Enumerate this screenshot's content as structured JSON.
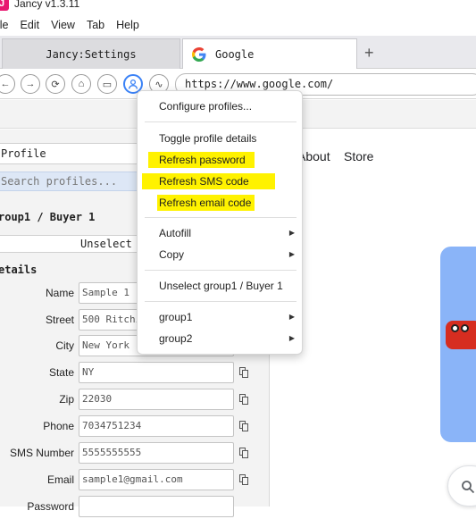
{
  "app": {
    "title": "Jancy v1.3.11",
    "logo_letter": "J"
  },
  "menubar": [
    "ile",
    "Edit",
    "View",
    "Tab",
    "Help"
  ],
  "tabs": [
    {
      "label": "Jancy:Settings",
      "active": false
    },
    {
      "label": "Google",
      "active": true
    }
  ],
  "new_tab_symbol": "+",
  "nav": {
    "url": "https://www.google.com/"
  },
  "panel": {
    "profile_select": "Profile",
    "search_placeholder": "Search profiles...",
    "group_label": "roup1 / Buyer 1",
    "unselect_label": "Unselect Prof",
    "details_label": "etails",
    "fields": [
      {
        "label": "Name",
        "value": "Sample 1"
      },
      {
        "label": "Street",
        "value": "500 Ritchie"
      },
      {
        "label": "City",
        "value": "New York"
      },
      {
        "label": "State",
        "value": "NY"
      },
      {
        "label": "Zip",
        "value": "22030"
      },
      {
        "label": "Phone",
        "value": "7034751234"
      },
      {
        "label": "SMS Number",
        "value": "5555555555"
      },
      {
        "label": "Email",
        "value": "sample1@gmail.com"
      },
      {
        "label": "Password",
        "value": ""
      }
    ]
  },
  "google": {
    "about": "About",
    "store": "Store"
  },
  "context_menu": {
    "configure": "Configure profiles...",
    "toggle_details": "Toggle profile details",
    "refresh_password": "Refresh password",
    "refresh_sms": "Refresh SMS code",
    "refresh_email": "Refresh email code",
    "autofill": "Autofill",
    "copy": "Copy",
    "unselect": "Unselect group1 / Buyer 1",
    "group1": "group1",
    "group2": "group2",
    "highlight_color": "#fff200"
  }
}
